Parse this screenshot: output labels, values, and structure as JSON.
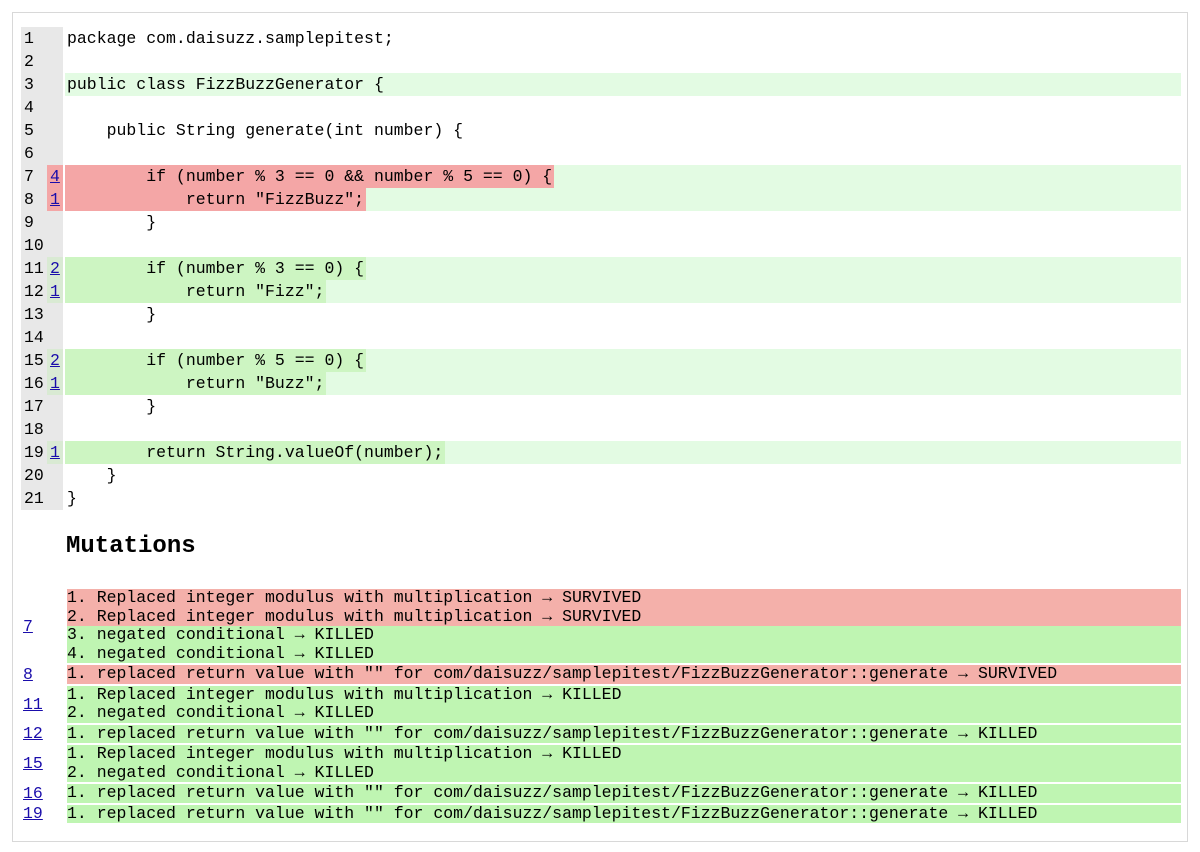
{
  "source_lines": [
    {
      "num": "1",
      "mut": "",
      "code": "package com.daisuzz.samplepitest;",
      "status": "none"
    },
    {
      "num": "2",
      "mut": "",
      "code": "",
      "status": "none"
    },
    {
      "num": "3",
      "mut": "",
      "code": "public class FizzBuzzGenerator {",
      "status": "covered"
    },
    {
      "num": "4",
      "mut": "",
      "code": "",
      "status": "none"
    },
    {
      "num": "5",
      "mut": "",
      "code": "    public String generate(int number) {",
      "status": "none"
    },
    {
      "num": "6",
      "mut": "",
      "code": "",
      "status": "none"
    },
    {
      "num": "7",
      "mut": "4",
      "code": "        if (number % 3 == 0 && number % 5 == 0) {",
      "status": "survived"
    },
    {
      "num": "8",
      "mut": "1",
      "code": "            return \"FizzBuzz\";",
      "status": "survived"
    },
    {
      "num": "9",
      "mut": "",
      "code": "        }",
      "status": "none"
    },
    {
      "num": "10",
      "mut": "",
      "code": "",
      "status": "none"
    },
    {
      "num": "11",
      "mut": "2",
      "code": "        if (number % 3 == 0) {",
      "status": "killed"
    },
    {
      "num": "12",
      "mut": "1",
      "code": "            return \"Fizz\";",
      "status": "killed"
    },
    {
      "num": "13",
      "mut": "",
      "code": "        }",
      "status": "none"
    },
    {
      "num": "14",
      "mut": "",
      "code": "",
      "status": "none"
    },
    {
      "num": "15",
      "mut": "2",
      "code": "        if (number % 5 == 0) {",
      "status": "killed"
    },
    {
      "num": "16",
      "mut": "1",
      "code": "            return \"Buzz\";",
      "status": "killed"
    },
    {
      "num": "17",
      "mut": "",
      "code": "        }",
      "status": "none"
    },
    {
      "num": "18",
      "mut": "",
      "code": "",
      "status": "none"
    },
    {
      "num": "19",
      "mut": "1",
      "code": "        return String.valueOf(number);",
      "status": "killed"
    },
    {
      "num": "20",
      "mut": "",
      "code": "    }",
      "status": "none"
    },
    {
      "num": "21",
      "mut": "",
      "code": "}",
      "status": "none"
    }
  ],
  "mutations_heading": "Mutations",
  "mutations": [
    {
      "line": "7",
      "items": [
        {
          "text": "1. Replaced integer modulus with multiplication → SURVIVED",
          "status": "survived"
        },
        {
          "text": "2. Replaced integer modulus with multiplication → SURVIVED",
          "status": "survived"
        },
        {
          "text": "3. negated conditional → KILLED",
          "status": "killed"
        },
        {
          "text": "4. negated conditional → KILLED",
          "status": "killed"
        }
      ]
    },
    {
      "line": "8",
      "items": [
        {
          "text": "1. replaced return value with \"\" for com/daisuzz/samplepitest/FizzBuzzGenerator::generate → SURVIVED",
          "status": "survived"
        }
      ]
    },
    {
      "line": "11",
      "items": [
        {
          "text": "1. Replaced integer modulus with multiplication → KILLED",
          "status": "killed"
        },
        {
          "text": "2. negated conditional → KILLED",
          "status": "killed"
        }
      ]
    },
    {
      "line": "12",
      "items": [
        {
          "text": "1. replaced return value with \"\" for com/daisuzz/samplepitest/FizzBuzzGenerator::generate → KILLED",
          "status": "killed"
        }
      ]
    },
    {
      "line": "15",
      "items": [
        {
          "text": "1. Replaced integer modulus with multiplication → KILLED",
          "status": "killed"
        },
        {
          "text": "2. negated conditional → KILLED",
          "status": "killed"
        }
      ]
    },
    {
      "line": "16",
      "items": [
        {
          "text": "1. replaced return value with \"\" for com/daisuzz/samplepitest/FizzBuzzGenerator::generate → KILLED",
          "status": "killed"
        }
      ]
    },
    {
      "line": "19",
      "items": [
        {
          "text": "1. replaced return value with \"\" for com/daisuzz/samplepitest/FizzBuzzGenerator::generate → KILLED",
          "status": "killed"
        }
      ]
    }
  ]
}
